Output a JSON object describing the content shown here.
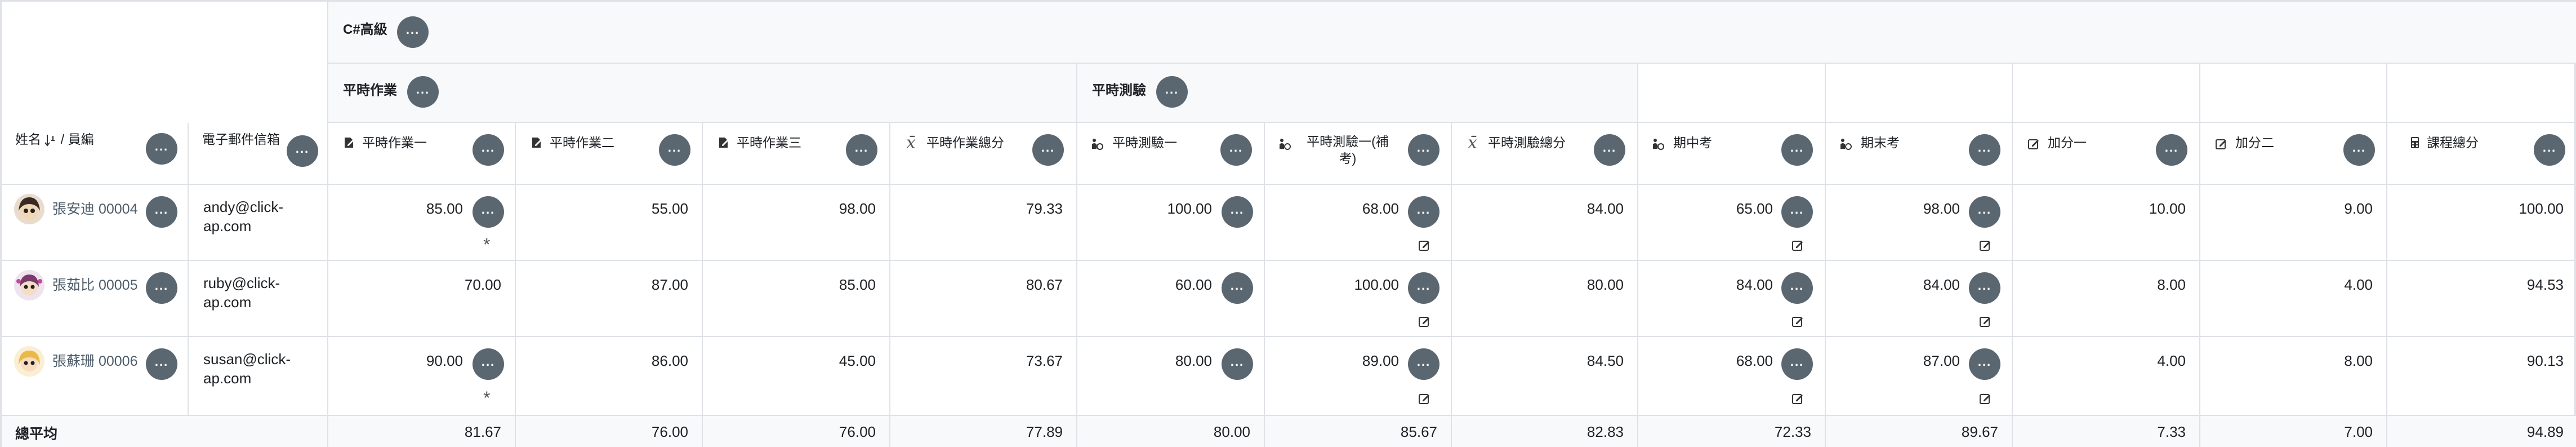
{
  "course": {
    "title": "C#高級"
  },
  "categories": {
    "homework": "平時作業",
    "quiz": "平時測驗"
  },
  "columns": {
    "name_sort": "姓名",
    "name_sep": "/",
    "emp_id": "員編",
    "email": "電子郵件信箱",
    "hw1": "平時作業一",
    "hw2": "平時作業二",
    "hw3": "平時作業三",
    "hw_total": "平時作業總分",
    "quiz1": "平時測驗一",
    "quiz1b": "平時測驗一(補考)",
    "quiz_total": "平時測驗總分",
    "midterm": "期中考",
    "final": "期末考",
    "bonus1": "加分一",
    "bonus2": "加分二",
    "course_total": "課程總分"
  },
  "icons": {
    "menu": "more-options-icon",
    "assignment": "assignment-icon",
    "quiz": "quiz-icon",
    "sum": "sigma-icon",
    "exam": "exam-icon",
    "bonus": "edit-square-icon",
    "calc": "calculator-icon",
    "sort": "sort-icon",
    "override": "override-edit-icon"
  },
  "students": [
    {
      "name": "張安迪",
      "id": "00004",
      "email": "andy@click-ap.com",
      "hw1": "85.00",
      "hw2": "55.00",
      "hw3": "98.00",
      "hw_total": "79.33",
      "quiz1": "100.00",
      "quiz1b": "68.00",
      "quiz_total": "84.00",
      "midterm": "65.00",
      "final": "98.00",
      "bonus1": "10.00",
      "bonus2": "9.00",
      "total": "100.00",
      "mark": "*"
    },
    {
      "name": "張茹比",
      "id": "00005",
      "email": "ruby@click-ap.com",
      "hw1": "70.00",
      "hw2": "87.00",
      "hw3": "85.00",
      "hw_total": "80.67",
      "quiz1": "60.00",
      "quiz1b": "100.00",
      "quiz_total": "80.00",
      "midterm": "84.00",
      "final": "84.00",
      "bonus1": "8.00",
      "bonus2": "4.00",
      "total": "94.53",
      "mark": ""
    },
    {
      "name": "張蘇珊",
      "id": "00006",
      "email": "susan@click-ap.com",
      "hw1": "90.00",
      "hw2": "86.00",
      "hw3": "45.00",
      "hw_total": "73.67",
      "quiz1": "80.00",
      "quiz1b": "89.00",
      "quiz_total": "84.50",
      "midterm": "68.00",
      "final": "87.00",
      "bonus1": "4.00",
      "bonus2": "8.00",
      "total": "90.13",
      "mark": "*"
    }
  ],
  "footer": {
    "label": "總平均",
    "hw1": "81.67",
    "hw2": "76.00",
    "hw3": "76.00",
    "hw_total": "77.89",
    "quiz1": "80.00",
    "quiz1b": "85.67",
    "quiz_total": "82.83",
    "midterm": "72.33",
    "final": "89.67",
    "bonus1": "7.33",
    "bonus2": "7.00",
    "total": "94.89"
  },
  "colors": {
    "button": "#5b6770",
    "border": "#dee2e6",
    "link": "#4e5d6b"
  }
}
